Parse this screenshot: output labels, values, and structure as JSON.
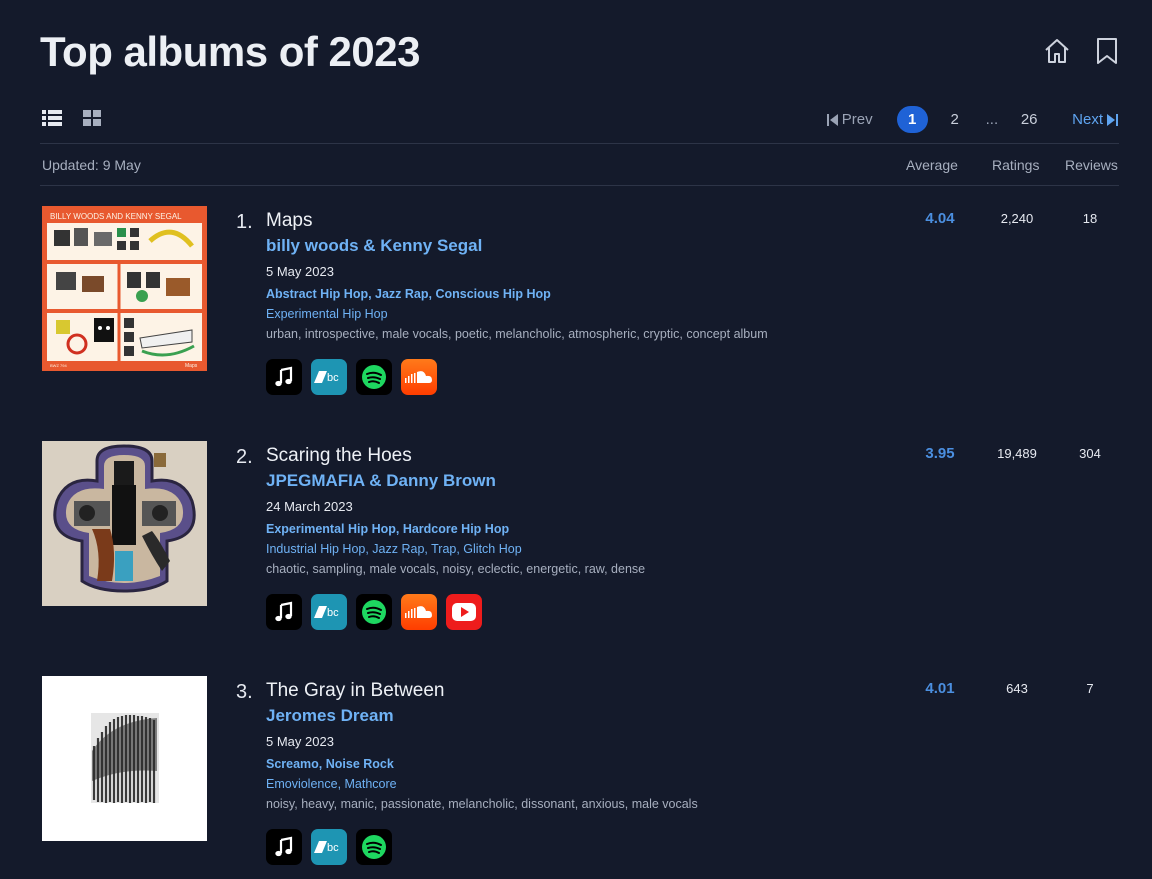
{
  "page": {
    "title": "Top albums of 2023"
  },
  "toolbar": {
    "updated": "Updated: 9 May"
  },
  "pagination": {
    "prev_label": "Prev",
    "pages": [
      "1",
      "2",
      "...",
      "26"
    ],
    "active_page": "1",
    "next_label": "Next"
  },
  "columns": {
    "average": "Average",
    "ratings": "Ratings",
    "reviews": "Reviews"
  },
  "albums": [
    {
      "rank": "1.",
      "title": "Maps",
      "artist": "billy woods & Kenny Segal",
      "date": "5 May 2023",
      "primary_genres": "Abstract Hip Hop, Jazz Rap, Conscious Hip Hop",
      "secondary_genres": "Experimental Hip Hop",
      "descriptors": "urban, introspective, male vocals, poetic, melancholic, atmospheric, cryptic, concept album",
      "average": "4.04",
      "ratings": "2,240",
      "reviews": "18",
      "links": [
        "apple-music-icon",
        "bandcamp-icon",
        "spotify-icon",
        "soundcloud-icon"
      ],
      "cover_text": {
        "header": "BILLY WOODS AND KENNY SEGAL",
        "catalog": "BWZ 794",
        "name": "Maps"
      }
    },
    {
      "rank": "2.",
      "title": "Scaring the Hoes",
      "artist": "JPEGMAFIA & Danny Brown",
      "date": "24 March 2023",
      "primary_genres": "Experimental Hip Hop, Hardcore Hip Hop",
      "secondary_genres": "Industrial Hip Hop, Jazz Rap, Trap, Glitch Hop",
      "descriptors": "chaotic, sampling, male vocals, noisy, eclectic, energetic, raw, dense",
      "average": "3.95",
      "ratings": "19,489",
      "reviews": "304",
      "links": [
        "apple-music-icon",
        "bandcamp-icon",
        "spotify-icon",
        "soundcloud-icon",
        "youtube-icon"
      ]
    },
    {
      "rank": "3.",
      "title": "The Gray in Between",
      "artist": "Jeromes Dream",
      "date": "5 May 2023",
      "primary_genres": "Screamo, Noise Rock",
      "secondary_genres": "Emoviolence, Mathcore",
      "descriptors": "noisy, heavy, manic, passionate, melancholic, dissonant, anxious, male vocals",
      "average": "4.01",
      "ratings": "643",
      "reviews": "7",
      "links": [
        "apple-music-icon",
        "bandcamp-icon",
        "spotify-icon"
      ]
    }
  ],
  "colors": {
    "background": "#141a2b",
    "accent_link": "#6fb2f5",
    "average_score": "#4b8fe0",
    "active_page": "#1f62d6"
  }
}
